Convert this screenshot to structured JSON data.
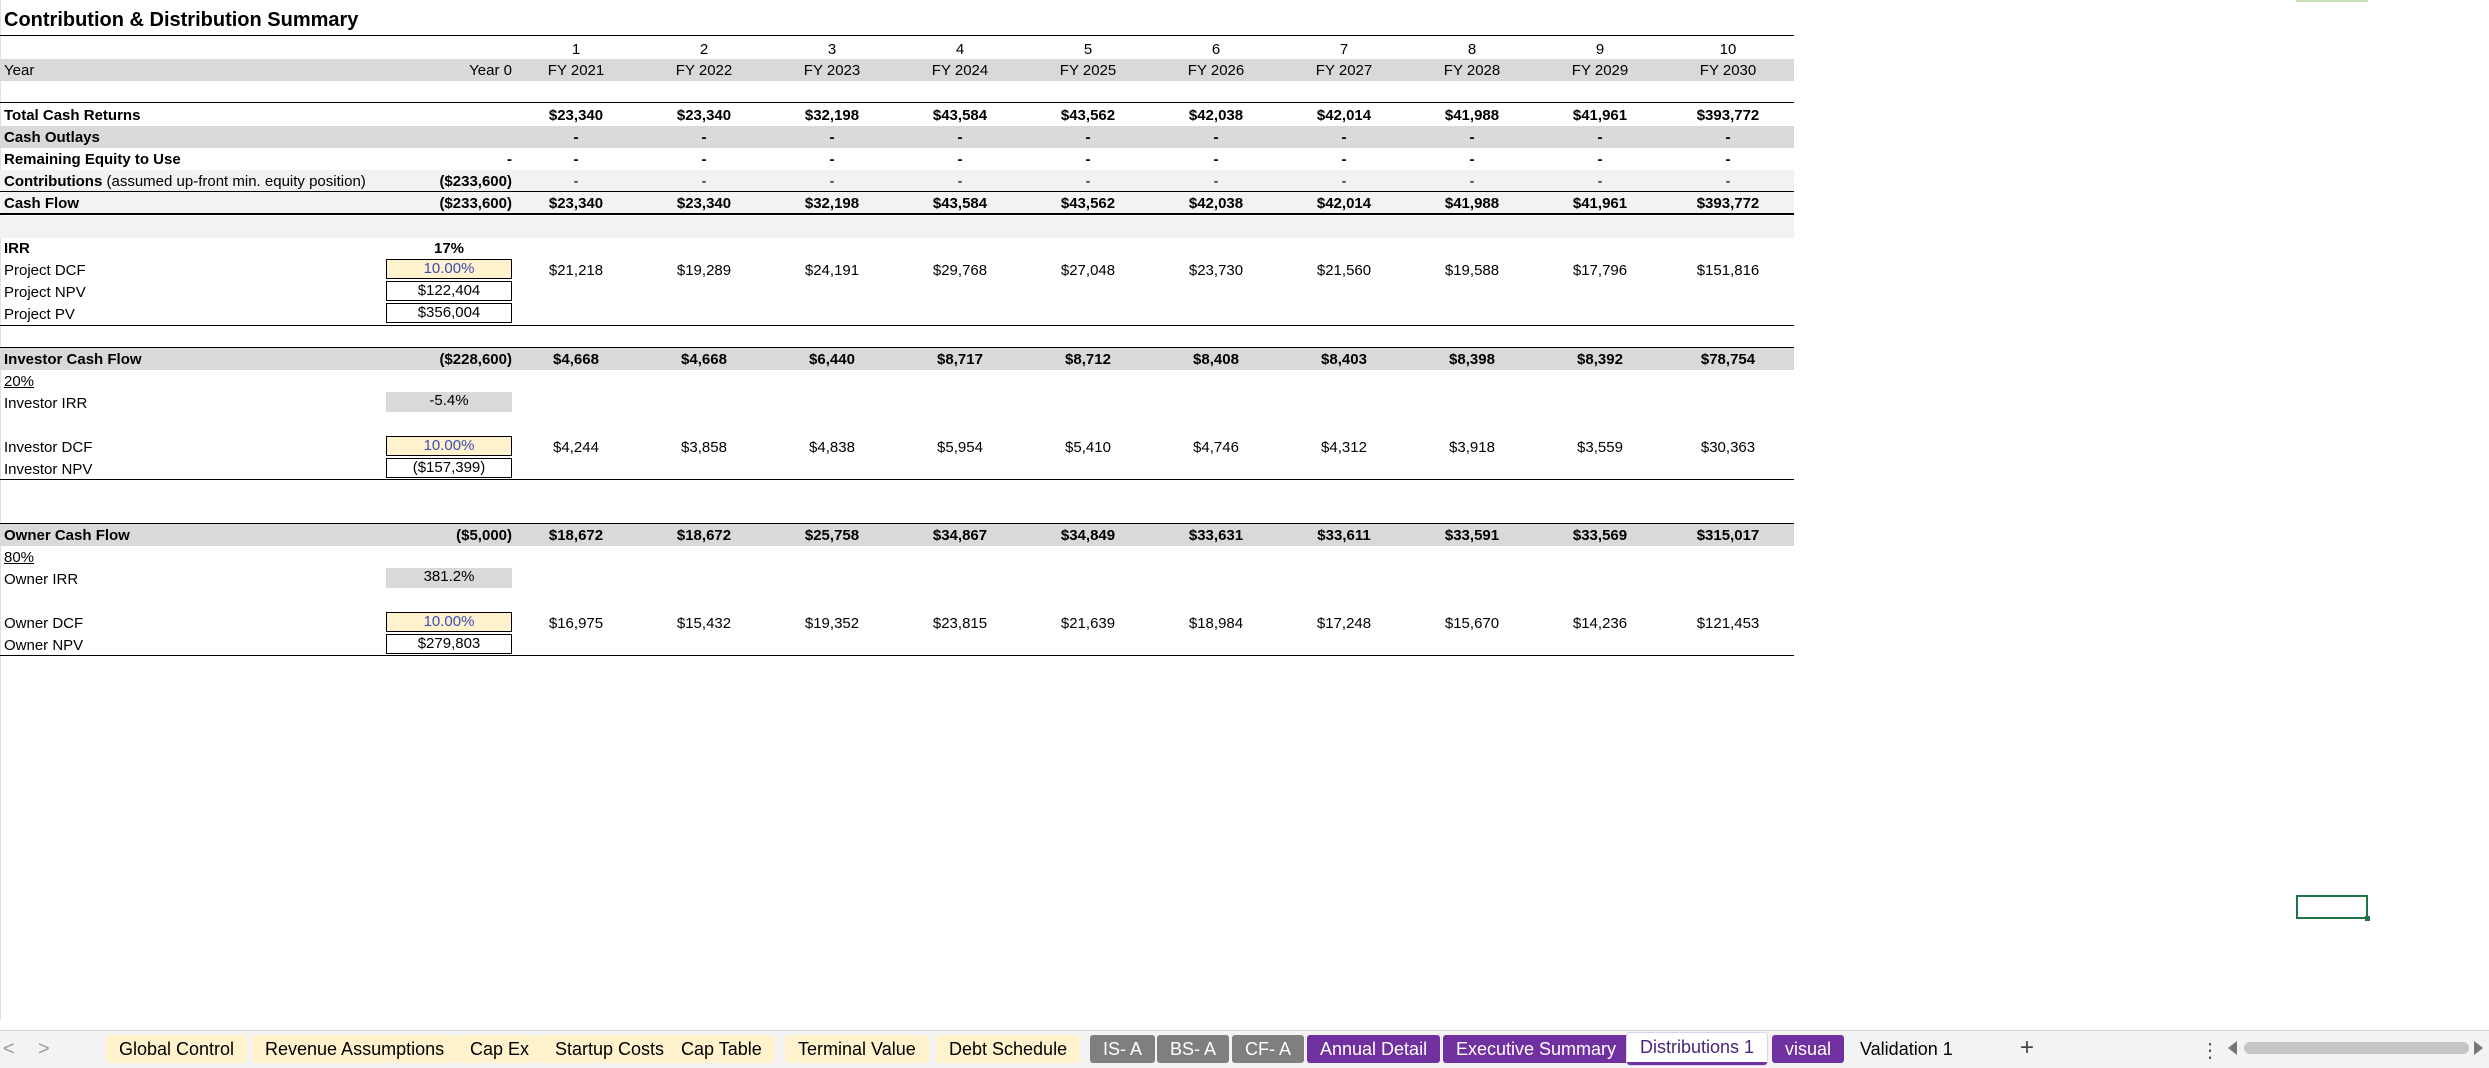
{
  "sheet_title": "Contribution & Distribution Summary",
  "header": {
    "periods": [
      "1",
      "2",
      "3",
      "4",
      "5",
      "6",
      "7",
      "8",
      "9",
      "10"
    ],
    "year_label": "Year",
    "year0_label": "Year 0",
    "fiscal_years": [
      "FY 2021",
      "FY 2022",
      "FY 2023",
      "FY 2024",
      "FY 2025",
      "FY 2026",
      "FY 2027",
      "FY 2028",
      "FY 2029",
      "FY 2030"
    ]
  },
  "cash": {
    "total_cash_returns": {
      "label": "Total Cash Returns",
      "year0": "",
      "values": [
        "$23,340",
        "$23,340",
        "$32,198",
        "$43,584",
        "$43,562",
        "$42,038",
        "$42,014",
        "$41,988",
        "$41,961",
        "$393,772"
      ]
    },
    "cash_outlays": {
      "label": "Cash Outlays",
      "year0": "",
      "values": [
        "-",
        "-",
        "-",
        "-",
        "-",
        "-",
        "-",
        "-",
        "-",
        "-"
      ]
    },
    "remaining_equity": {
      "label": "Remaining Equity to Use",
      "year0": "-",
      "values": [
        "-",
        "-",
        "-",
        "-",
        "-",
        "-",
        "-",
        "-",
        "-",
        "-"
      ]
    },
    "contributions": {
      "label": "Contributions",
      "note": "(assumed up-front min. equity position)",
      "year0": "($233,600)",
      "values": [
        "-",
        "-",
        "-",
        "-",
        "-",
        "-",
        "-",
        "-",
        "-",
        "-"
      ]
    },
    "cash_flow": {
      "label": "Cash Flow",
      "year0": "($233,600)",
      "values": [
        "$23,340",
        "$23,340",
        "$32,198",
        "$43,584",
        "$43,562",
        "$42,038",
        "$42,014",
        "$41,988",
        "$41,961",
        "$393,772"
      ]
    }
  },
  "project": {
    "irr_label": "IRR",
    "irr_value": "17%",
    "dcf_label": "Project DCF",
    "dcf_rate": "10.00%",
    "dcf_values": [
      "$21,218",
      "$19,289",
      "$24,191",
      "$29,768",
      "$27,048",
      "$23,730",
      "$21,560",
      "$19,588",
      "$17,796",
      "$151,816"
    ],
    "npv_label": "Project NPV",
    "npv_value": "$122,404",
    "pv_label": "Project PV",
    "pv_value": "$356,004"
  },
  "investor": {
    "cf_label": "Investor Cash Flow",
    "cf_year0": "($228,600)",
    "cf_values": [
      "$4,668",
      "$4,668",
      "$6,440",
      "$8,717",
      "$8,712",
      "$8,408",
      "$8,403",
      "$8,398",
      "$8,392",
      "$78,754"
    ],
    "share": "20%",
    "irr_label": "Investor IRR",
    "irr_value": "-5.4%",
    "dcf_label": "Investor DCF",
    "dcf_rate": "10.00%",
    "dcf_values": [
      "$4,244",
      "$3,858",
      "$4,838",
      "$5,954",
      "$5,410",
      "$4,746",
      "$4,312",
      "$3,918",
      "$3,559",
      "$30,363"
    ],
    "npv_label": "Investor NPV",
    "npv_value": "($157,399)"
  },
  "owner": {
    "cf_label": "Owner Cash Flow",
    "cf_year0": "($5,000)",
    "cf_values": [
      "$18,672",
      "$18,672",
      "$25,758",
      "$34,867",
      "$34,849",
      "$33,631",
      "$33,611",
      "$33,591",
      "$33,569",
      "$315,017"
    ],
    "share": "80%",
    "irr_label": "Owner IRR",
    "irr_value": "381.2%",
    "dcf_label": "Owner DCF",
    "dcf_rate": "10.00%",
    "dcf_values": [
      "$16,975",
      "$15,432",
      "$19,352",
      "$23,815",
      "$21,639",
      "$18,984",
      "$17,248",
      "$15,670",
      "$14,236",
      "$121,453"
    ],
    "npv_label": "Owner NPV",
    "npv_value": "$279,803"
  },
  "tabs": [
    {
      "label": "Global Control",
      "color": "yellow"
    },
    {
      "label": "Revenue Assumptions",
      "color": "yellow"
    },
    {
      "label": "Cap Ex",
      "color": "yellow"
    },
    {
      "label": "Startup Costs",
      "color": "yellow"
    },
    {
      "label": "Cap Table",
      "color": "yellow"
    },
    {
      "label": "Terminal Value",
      "color": "yellow"
    },
    {
      "label": "Debt Schedule",
      "color": "yellow"
    },
    {
      "label": "IS- A",
      "color": "gray"
    },
    {
      "label": "BS- A",
      "color": "gray"
    },
    {
      "label": "CF- A",
      "color": "gray"
    },
    {
      "label": "Annual Detail",
      "color": "purple"
    },
    {
      "label": "Executive Summary",
      "color": "purple"
    },
    {
      "label": "Distributions 1",
      "color": "active"
    },
    {
      "label": "visual",
      "color": "purple"
    },
    {
      "label": "Validation 1",
      "color": "none"
    }
  ],
  "tabbar": {
    "prev": "<",
    "next": ">",
    "add": "+",
    "more": "⋮"
  }
}
